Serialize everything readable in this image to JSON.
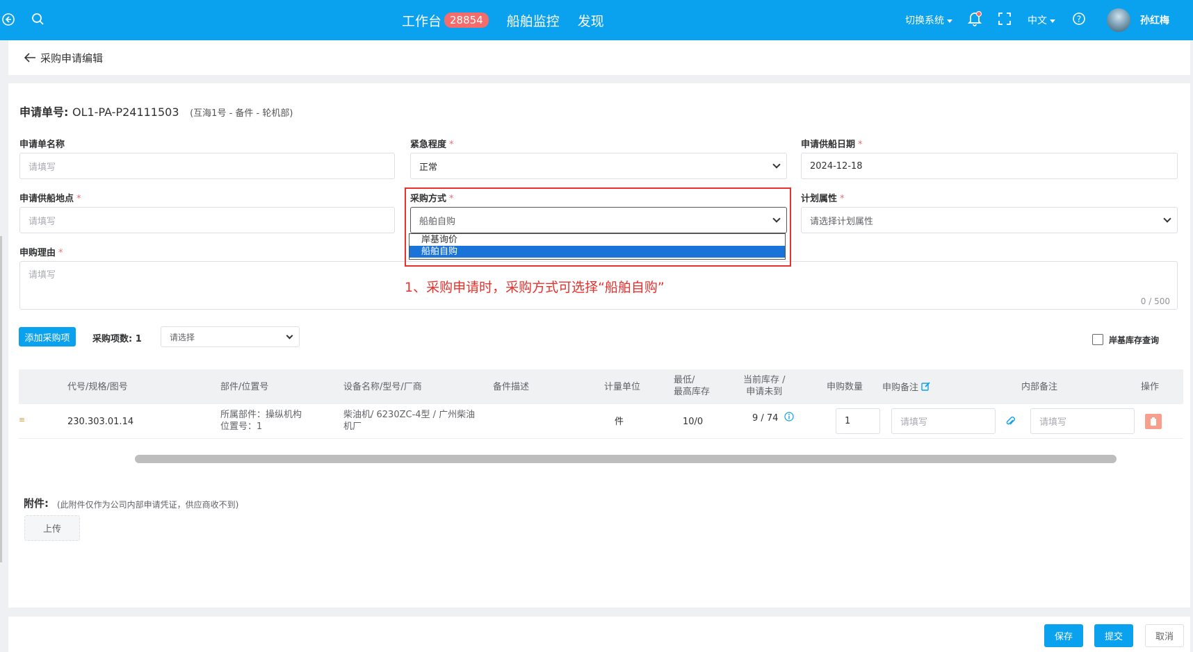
{
  "topbar": {
    "nav": [
      {
        "label": "工作台",
        "badge": "28854"
      },
      {
        "label": "船舶监控"
      },
      {
        "label": "发现"
      }
    ],
    "switch_system": "切换系统",
    "language": "中文",
    "user_name": "孙红梅"
  },
  "breadcrumb": {
    "title": "采购申请编辑"
  },
  "order": {
    "label": "申请单号:",
    "number": "OL1-PA-P24111503",
    "sub": "(互海1号 - 备件 - 轮机部)"
  },
  "form": {
    "name": {
      "label": "申请单名称",
      "placeholder": "请填写"
    },
    "urgency": {
      "label": "紧急程度",
      "value": "正常"
    },
    "supply_date": {
      "label": "申请供船日期",
      "value": "2024-12-18"
    },
    "supply_place": {
      "label": "申请供船地点",
      "placeholder": "请填写"
    },
    "purchase_method": {
      "label": "采购方式",
      "value": "船舶自购",
      "options": [
        "岸基询价",
        "船舶自购"
      ]
    },
    "plan_attr": {
      "label": "计划属性",
      "placeholder": "请选择计划属性"
    },
    "reason": {
      "label": "申购理由",
      "placeholder": "请填写",
      "counter": "0 / 500"
    },
    "required_mark": "*"
  },
  "annotation": "1、采购申请时，采购方式可选择“船舶自购”",
  "toolbar": {
    "add_button": "添加采购项",
    "count_label": "采购项数:",
    "count_value": "1",
    "select_placeholder": "请选择",
    "stock_query": "岸基库存查询"
  },
  "table": {
    "headers": {
      "code": "代号/规格/图号",
      "part": "部件/位置号",
      "equipment": "设备名称/型号/厂商",
      "desc": "备件描述",
      "unit": "计量单位",
      "minmax_1": "最低/",
      "minmax_2": "最高库存",
      "stock_1": "当前库存 /",
      "stock_2": "申请未到",
      "qty": "申购数量",
      "remark": "申购备注",
      "internal": "内部备注",
      "ops": "操作"
    },
    "rows": [
      {
        "code": "230.303.01.14",
        "part_1": "所属部件：操纵机构",
        "part_2": "位置号：1",
        "equip_1": "柴油机/ 6230ZC-4型 / 广州柴油",
        "equip_2": "机厂",
        "unit": "件",
        "minmax": "10/0",
        "stock": "9 / 74",
        "qty": "1",
        "remark_placeholder": "请填写",
        "internal_placeholder": "请填写"
      }
    ]
  },
  "attachments": {
    "label": "附件:",
    "note": "(此附件仅作为公司内部申请凭证，供应商收不到)",
    "upload": "上传"
  },
  "footer": {
    "save": "保存",
    "submit": "提交",
    "cancel": "取消"
  }
}
